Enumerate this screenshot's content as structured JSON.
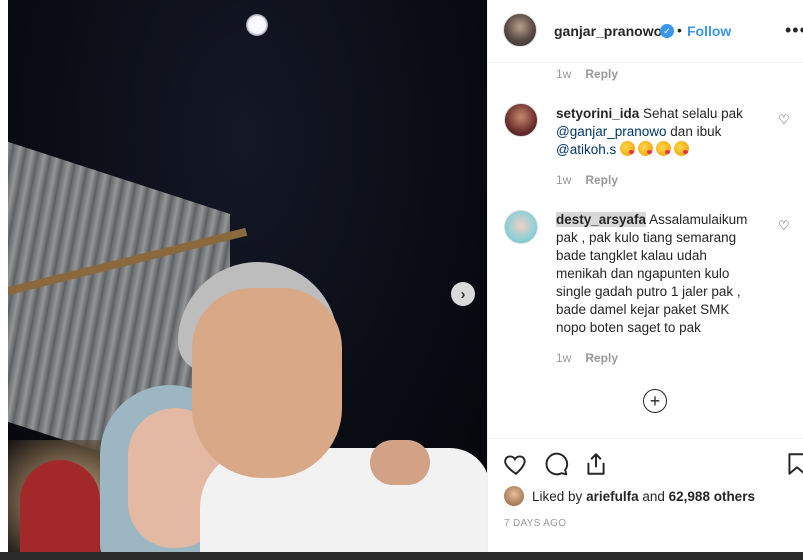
{
  "post": {
    "username": "ganjar_pranowo",
    "verified_glyph": "✓",
    "separator": "•",
    "follow_label": "Follow",
    "more_glyph": "•••",
    "next_glyph": "›"
  },
  "first_comment_meta": {
    "age": "1w",
    "reply": "Reply"
  },
  "comments": [
    {
      "username": "setyorini_ida",
      "text_1": "Sehat selalu pak",
      "mention_1": "@ganjar_pranowo",
      "text_2": "dan ibuk",
      "mention_2": "@atikoh.s",
      "emojis": [
        "😘",
        "😘",
        "😘",
        "😘"
      ],
      "age": "1w",
      "reply": "Reply"
    },
    {
      "username": "desty_arsyafa",
      "text": "Assalamulaikum pak , pak kulo tiang semarang bade tangklet kalau udah menikah dan ngapunten kulo single gadah putro 1 jaler pak , bade damel kejar paket SMK nopo boten saget to pak",
      "age": "1w",
      "reply": "Reply"
    }
  ],
  "load_more_glyph": "+",
  "actions": {
    "icons": [
      "heart-icon",
      "comment-icon",
      "share-icon",
      "bookmark-icon"
    ]
  },
  "likes": {
    "prefix": "Liked by",
    "user": "ariefulfa",
    "middle": "and",
    "count": "62,988 others"
  },
  "date": "7 DAYS AGO",
  "colors": {
    "accent": "#3897f0",
    "mention": "#003569",
    "muted": "#999999"
  }
}
